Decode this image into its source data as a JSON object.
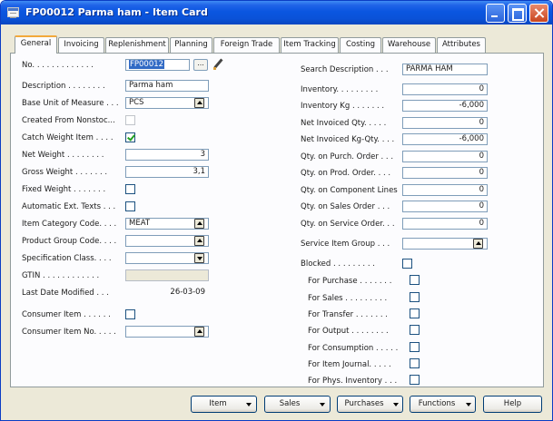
{
  "window": {
    "title": "FP00012 Parma ham - Item Card"
  },
  "tabs": [
    "General",
    "Invoicing",
    "Replenishment",
    "Planning",
    "Foreign Trade",
    "Item Tracking",
    "Costing",
    "Warehouse",
    "Attributes"
  ],
  "left": {
    "no_label": "No. . . . . . . . . . . . .",
    "no_value": "FP00012",
    "description_label": "Description . . . . . . . .",
    "description_value": "Parma ham",
    "base_uom_label": "Base Unit of Measure . . .",
    "base_uom_value": "PCS",
    "created_from_label": "Created From Nonstoc...",
    "catch_weight_label": "Catch Weight Item . . . .",
    "net_weight_label": "Net Weight . . . . . . . .",
    "net_weight_value": "3",
    "gross_weight_label": "Gross Weight . . . . . . .",
    "gross_weight_value": "3,1",
    "fixed_weight_label": "Fixed Weight . . . . . . .",
    "auto_ext_texts_label": "Automatic Ext. Texts . . .",
    "item_category_label": "Item Category Code. . . .",
    "item_category_value": "MEAT",
    "product_group_label": "Product Group Code. . . .",
    "product_group_value": "",
    "specification_label": "Specification Class. . . .",
    "specification_value": "",
    "gtin_label": "GTIN . . . . . . . . . . . .",
    "gtin_value": "",
    "last_modified_label": "Last Date Modified . . .",
    "last_modified_value": "26-03-09",
    "consumer_item_label": "Consumer Item . . . . . .",
    "consumer_item_no_label": "Consumer Item No. . . . .",
    "consumer_item_no_value": ""
  },
  "right": {
    "search_desc_label": "Search Description . . .",
    "search_desc_value": "PARMA HAM",
    "inventory_label": "Inventory. . . . . . . . .",
    "inventory_value": "0",
    "inventory_kg_label": "Inventory Kg . . . . . . .",
    "inventory_kg_value": "-6,000",
    "net_invoiced_label": "Net Invoiced Qty. . . . .",
    "net_invoiced_value": "0",
    "net_invoiced_kg_label": "Net Invoiced Kg-Qty. . . .",
    "net_invoiced_kg_value": "-6,000",
    "purch_order_label": "Qty. on Purch. Order . . .",
    "purch_order_value": "0",
    "prod_order_label": "Qty. on Prod. Order. . . .",
    "prod_order_value": "0",
    "component_lines_label": "Qty. on Component Lines",
    "component_lines_value": "0",
    "sales_order_label": "Qty. on Sales Order . . .",
    "sales_order_value": "0",
    "service_order_label": "Qty. on Service Order. . .",
    "service_order_value": "0",
    "service_group_label": "Service Item Group . . .",
    "service_group_value": "",
    "blocked_label": "Blocked . . . . . . . . .",
    "for_purchase_label": "For Purchase . . . . . . .",
    "for_sales_label": "For Sales . . . . . . . . .",
    "for_transfer_label": "For Transfer . . . . . . .",
    "for_output_label": "For Output . . . . . . . .",
    "for_consumption_label": "For Consumption . . . . .",
    "for_item_journal_label": "For Item Journal. . . . .",
    "for_phys_inventory_label": "For Phys. Inventory . . ."
  },
  "checkboxes": {
    "created_from": false,
    "catch_weight": true,
    "fixed_weight": false,
    "auto_ext_texts": false,
    "consumer_item": false,
    "blocked": false,
    "for_purchase": false,
    "for_sales": false,
    "for_transfer": false,
    "for_output": false,
    "for_consumption": false,
    "for_item_journal": false,
    "for_phys_inventory": false
  },
  "buttons": {
    "item": "Item",
    "sales": "Sales",
    "purchases": "Purchases",
    "functions": "Functions",
    "help": "Help"
  },
  "colors": {
    "title_bar": "#0a56e0",
    "active_tab_accent": "#f2a93b",
    "panel": "#fcfcfe",
    "window": "#ece9d8",
    "selection": "#316ac5"
  }
}
